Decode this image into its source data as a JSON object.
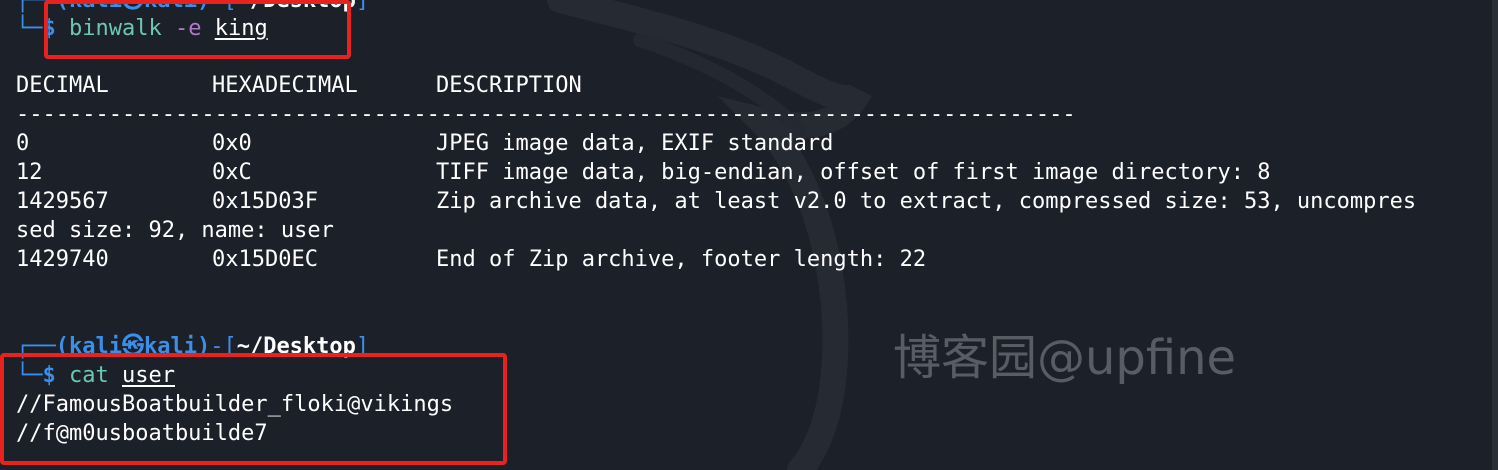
{
  "prompt": {
    "user_host": "(kali㉿kali)",
    "cwd_partial": "~/Desktop",
    "cwd": "~/Desktop",
    "dollar": "$"
  },
  "command1": {
    "program": "binwalk",
    "flag": "-e",
    "argument": "king"
  },
  "binwalk_table": {
    "headers": [
      "DECIMAL",
      "HEXADECIMAL",
      "DESCRIPTION"
    ],
    "separator": "--------------------------------------------------------------------------------",
    "rows": [
      {
        "decimal": "0",
        "hex": "0x0",
        "description": "JPEG image data, EXIF standard"
      },
      {
        "decimal": "12",
        "hex": "0xC",
        "description": "TIFF image data, big-endian, offset of first image directory: 8"
      },
      {
        "decimal": "1429567",
        "hex": "0x15D03F",
        "description": "Zip archive data, at least v2.0 to extract, compressed size: 53, uncompres"
      },
      {
        "decimal": "1429740",
        "hex": "0x15D0EC",
        "description": "End of Zip archive, footer length: 22"
      }
    ],
    "wrap_line": "sed size: 92, name: user"
  },
  "command2": {
    "program": "cat",
    "argument": "user"
  },
  "output": [
    "//FamousBoatbuilder_floki@vikings",
    "//f@m0usboatbuilde7"
  ],
  "watermark": "博客园@upfine",
  "colors": {
    "background": "#1c2028",
    "prompt_blue": "#3b8eea",
    "command_teal": "#6ec6b4",
    "flag_purple": "#b079c9",
    "highlight_red": "#e8231f"
  }
}
